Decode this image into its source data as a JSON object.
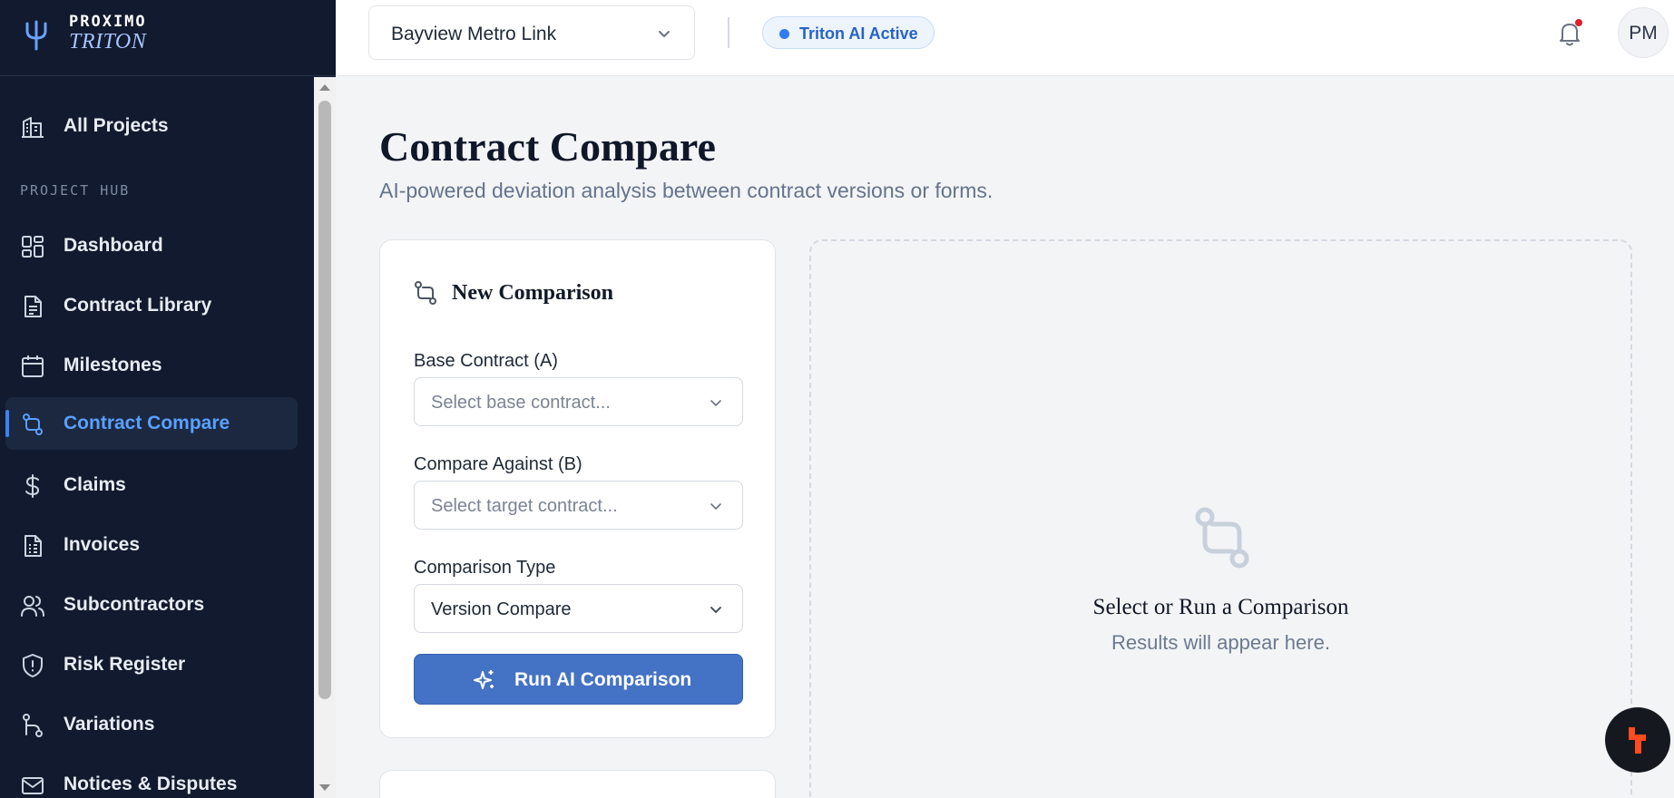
{
  "brand": {
    "top": "PROXIMO",
    "bottom": "TRITON"
  },
  "sidebar": {
    "top_item": {
      "label": "All Projects",
      "icon": "building-icon"
    },
    "section_label": "PROJECT HUB",
    "items": [
      {
        "label": "Dashboard",
        "icon": "dashboard-icon",
        "active": false
      },
      {
        "label": "Contract Library",
        "icon": "document-icon",
        "active": false
      },
      {
        "label": "Milestones",
        "icon": "calendar-icon",
        "active": false
      },
      {
        "label": "Contract Compare",
        "icon": "compare-icon",
        "active": true
      },
      {
        "label": "Claims",
        "icon": "dollar-icon",
        "active": false
      },
      {
        "label": "Invoices",
        "icon": "invoice-icon",
        "active": false
      },
      {
        "label": "Subcontractors",
        "icon": "users-icon",
        "active": false
      },
      {
        "label": "Risk Register",
        "icon": "shield-icon",
        "active": false
      },
      {
        "label": "Variations",
        "icon": "variations-icon",
        "active": false
      },
      {
        "label": "Notices & Disputes",
        "icon": "mail-icon",
        "active": false
      }
    ]
  },
  "header": {
    "project": "Bayview Metro Link",
    "ai_status": "Triton AI Active",
    "avatar_initials": "PM"
  },
  "main": {
    "title": "Contract Compare",
    "subtitle": "AI-powered deviation analysis between contract versions or forms."
  },
  "comparison_form": {
    "title": "New Comparison",
    "base_label": "Base Contract (A)",
    "base_placeholder": "Select base contract...",
    "target_label": "Compare Against (B)",
    "target_placeholder": "Select target contract...",
    "type_label": "Comparison Type",
    "type_value": "Version Compare",
    "run_label": "Run AI Comparison"
  },
  "results": {
    "title": "Select or Run a Comparison",
    "subtitle": "Results will appear here."
  },
  "colors": {
    "sidebar_bg": "#111a2e",
    "accent": "#3b82f6",
    "primary_button": "#4472c4",
    "notification_dot": "#e11d2a"
  }
}
